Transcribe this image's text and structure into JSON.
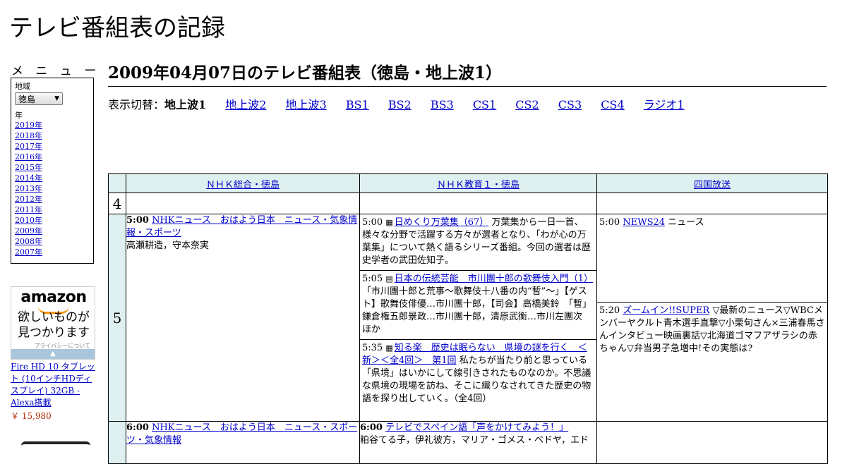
{
  "site_title": "テレビ番組表の記録",
  "menu": {
    "heading": "メ ニ ュ ー",
    "region_label": "地域",
    "region_value": "徳島",
    "year_label": "年",
    "years": [
      "2019年",
      "2018年",
      "2017年",
      "2016年",
      "2015年",
      "2014年",
      "2013年",
      "2012年",
      "2011年",
      "2010年",
      "2009年",
      "2008年",
      "2007年"
    ]
  },
  "ad": {
    "logo": "amazon",
    "copy_line1": "欲しいものが",
    "copy_line2": "見つかります",
    "privacy": "プライバシーについて",
    "product": "Fire HD 10 タブレット (10インチHDディスプレイ) 32GB - Alexa搭載",
    "price": "￥ 15,980"
  },
  "page_title": "2009年04月07日のテレビ番組表（徳島・地上波1）",
  "switcher": {
    "label": "表示切替：",
    "current": "地上波1",
    "links": [
      "地上波2",
      "地上波3",
      "BS1",
      "BS2",
      "BS3",
      "CS1",
      "CS2",
      "CS3",
      "CS4",
      "ラジオ1"
    ]
  },
  "channels": [
    "ＮＨＫ総合・徳島",
    "ＮＨＫ教育１・徳島",
    "四国放送"
  ],
  "hours": [
    "4",
    "5"
  ],
  "programs": {
    "nhk_5": {
      "time": "5:00",
      "title": "NHKニュース　おはよう日本　ニュース・気象情報・スポーツ",
      "desc": "高瀬耕造，守本奈実"
    },
    "edu_500": {
      "time": "5:00",
      "icon": "▦",
      "title": "日めくり万葉集（67）",
      "desc": "万葉集から一日一首、様々な分野で活躍する方々が選者となり、「わが心の万葉集」について熱く語るシリーズ番組。今回の選者は歴史学者の武田佐知子。"
    },
    "edu_505": {
      "time": "5:05",
      "icon": "▤",
      "title": "日本の伝統芸能　市川團十郎の歌舞伎入門（1）",
      "desc": "「市川團十郎と荒事～歌舞伎十八番の内“暫”～」【ゲスト】歌舞伎俳優…市川團十郎，【司会】高橋美鈴　「暫」鎌倉権五郎景政…市川團十郎，清原武衡…市川左團次　ほか"
    },
    "edu_535": {
      "time": "5:35",
      "icon": "▦",
      "title": "知る楽　歴史は眠らない　県境の謎を行く　＜新＞＜全4回＞　第1回",
      "desc": "私たちが当たり前と思っている「県境」はいかにして線引きされたものなのか。不思議な県境の現場を訪ね、そこに織りなされてきた歴史の物語を探り出していく。（全4回）"
    },
    "shikoku_500": {
      "time": "5:00",
      "title": "NEWS24",
      "desc": "ニュース"
    },
    "shikoku_520": {
      "time": "5:20",
      "title": "ズームイン!!SUPER",
      "desc": "▽最新のニュース▽WBCメンバーヤクルト青木選手直撃▽小栗旬さん×三浦春馬さんインタビュー映画裏話▽北海道ゴマフアザラシの赤ちゃん▽弁当男子急増中!その実態は?"
    },
    "nhk_6": {
      "time": "6:00",
      "title": "NHKニュース　おはよう日本　ニュース・スポーツ・気象情報",
      "desc": ""
    },
    "edu_600": {
      "time": "6:00",
      "title": "テレビでスペイン語「声をかけてみよう！」",
      "desc": "粕谷てる子，伊礼彼方，マリア・ゴメス・ベドヤ，エド"
    }
  }
}
